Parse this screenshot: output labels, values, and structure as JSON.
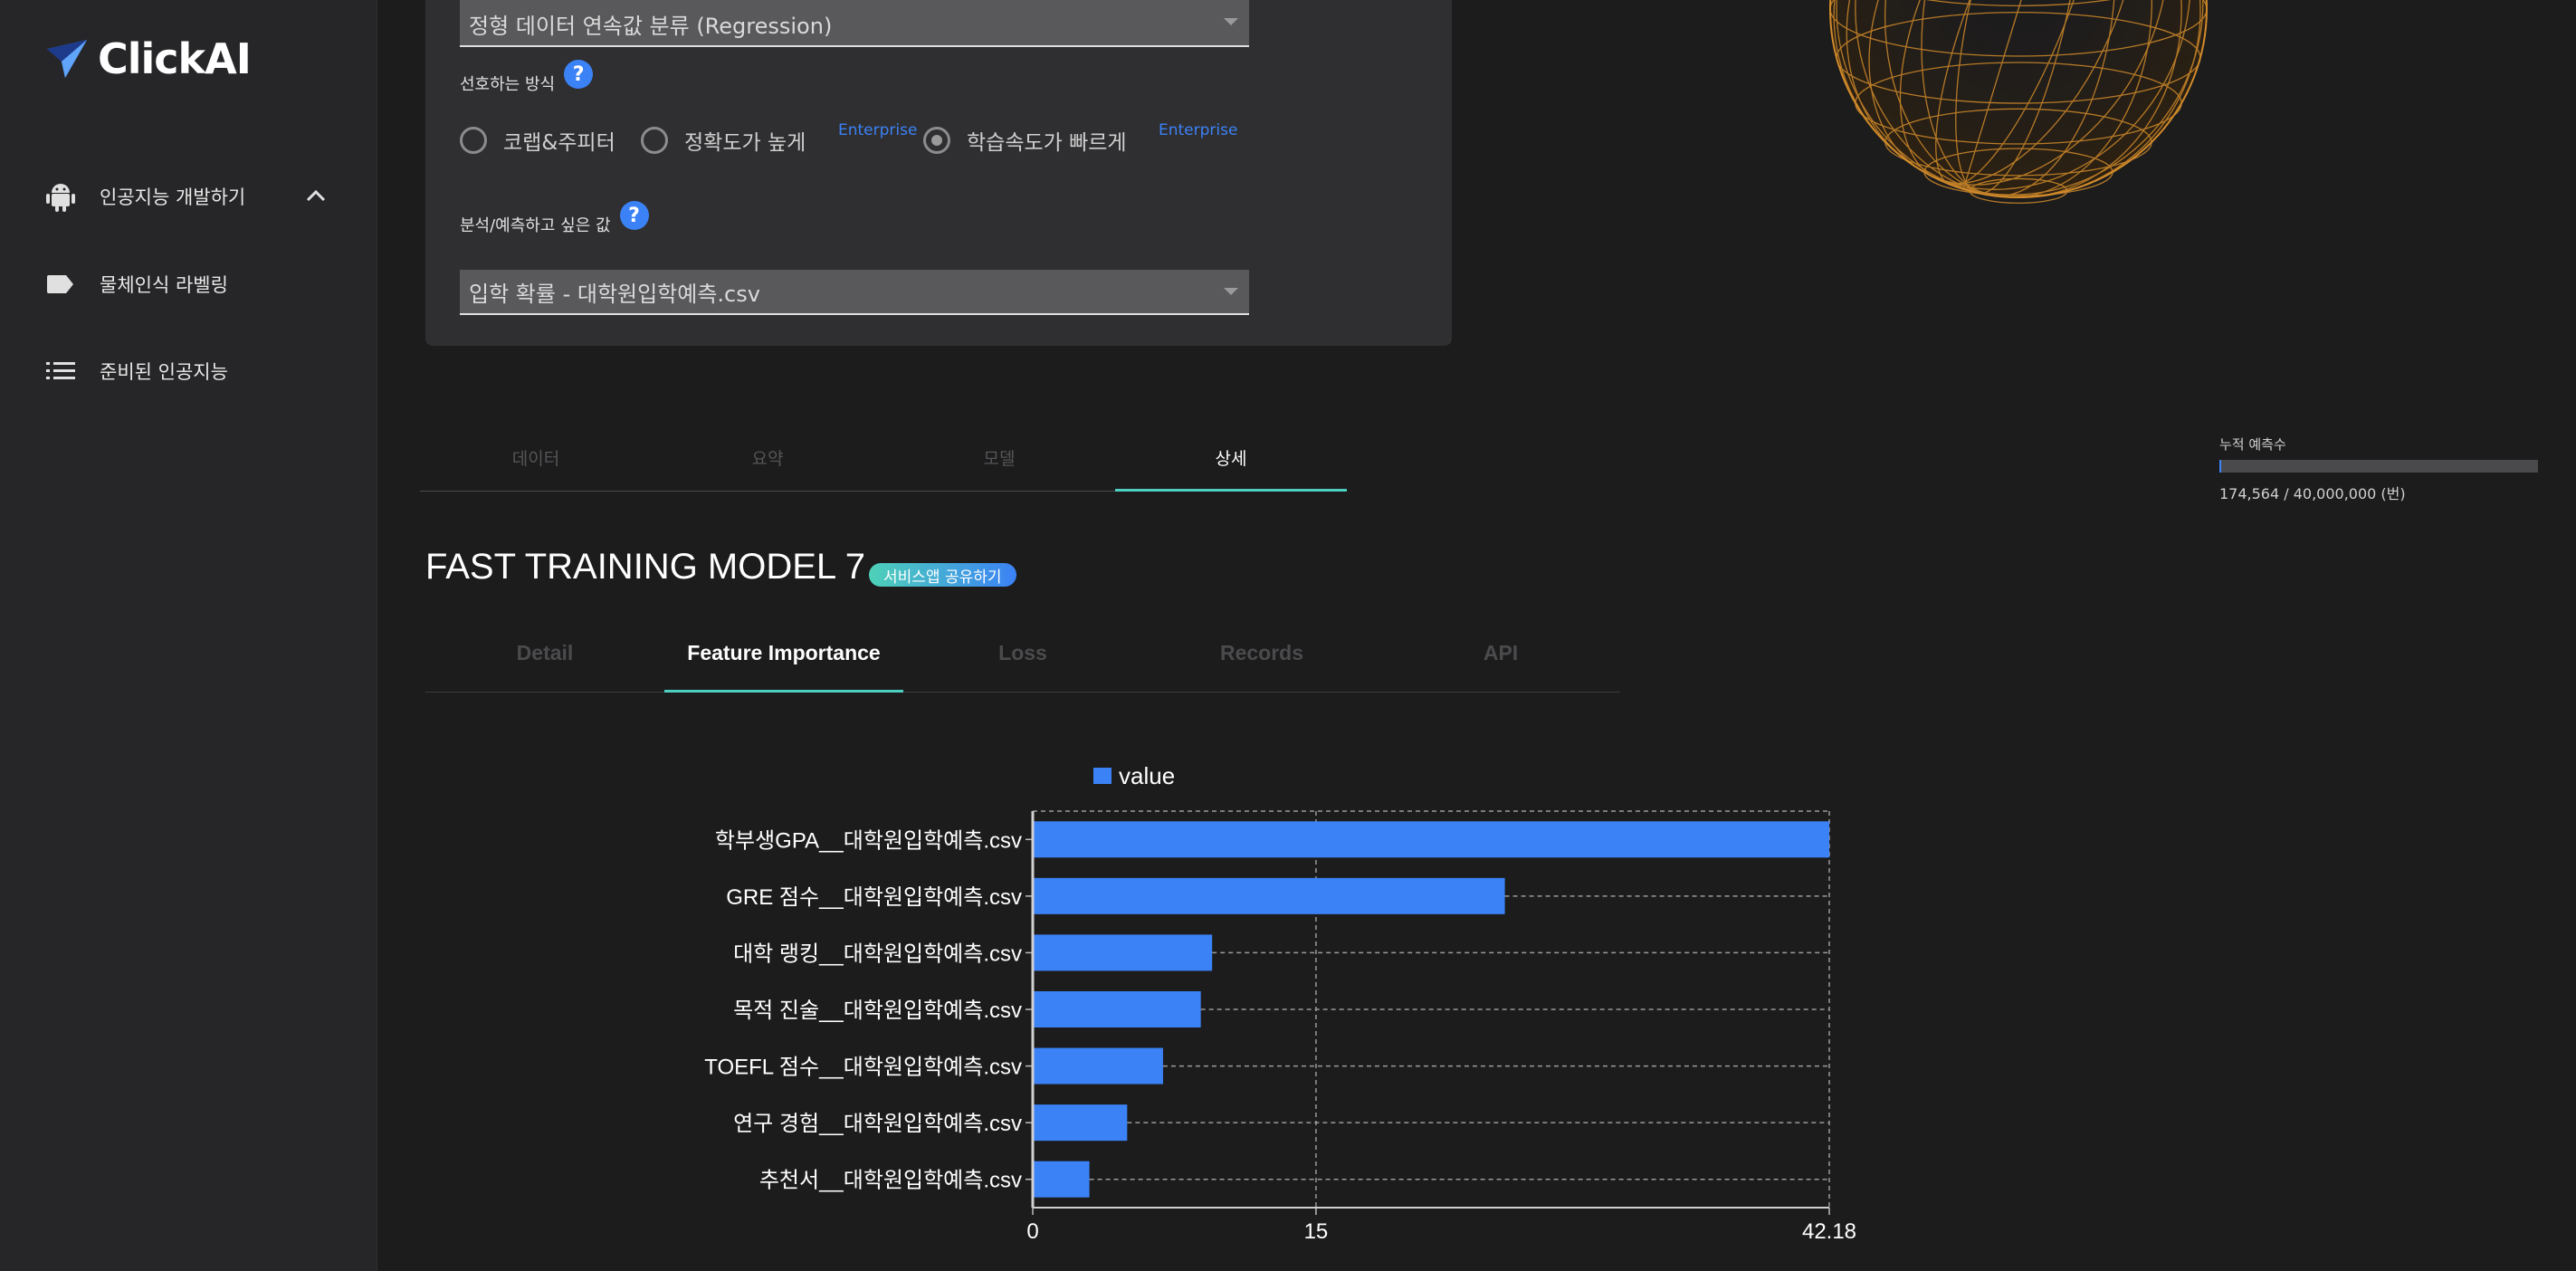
{
  "app": {
    "name": "ClickAI"
  },
  "sidebar": {
    "items": [
      {
        "label": "인공지능 개발하기",
        "icon": "android-icon",
        "expanded": true
      },
      {
        "label": "물체인식 라벨링",
        "icon": "label-tag-icon"
      },
      {
        "label": "준비된 인공지능",
        "icon": "list-icon"
      }
    ]
  },
  "form": {
    "problem_type": {
      "value": "정형 데이터 연속값 분류 (Regression)"
    },
    "preference": {
      "label": "선호하는 방식",
      "help": "?",
      "options": [
        {
          "label": "코랩&주피터",
          "selected": false,
          "badge": ""
        },
        {
          "label": "정확도가 높게",
          "selected": false,
          "badge": "Enterprise"
        },
        {
          "label": "학습속도가 빠르게",
          "selected": true,
          "badge": "Enterprise"
        }
      ]
    },
    "target": {
      "label": "분석/예측하고 싶은 값",
      "help": "?",
      "value": "입학 확률 - 대학원입학예측.csv"
    }
  },
  "prediction_count": {
    "label": "누적 예측수",
    "value_text": "174,564 / 40,000,000 (번)",
    "fraction": 0.0044
  },
  "top_tabs": [
    {
      "label": "데이터",
      "active": false
    },
    {
      "label": "요약",
      "active": false
    },
    {
      "label": "모델",
      "active": false
    },
    {
      "label": "상세",
      "active": true
    }
  ],
  "model": {
    "title": "FAST TRAINING MODEL 7",
    "share_label": "서비스앱 공유하기"
  },
  "sub_tabs": [
    {
      "label": "Detail",
      "active": false
    },
    {
      "label": "Feature Importance",
      "active": true
    },
    {
      "label": "Loss",
      "active": false
    },
    {
      "label": "Records",
      "active": false
    },
    {
      "label": "API",
      "active": false
    }
  ],
  "colors": {
    "accent": "#3b82f6",
    "tab_indicator": "#4dd0c1",
    "globe": "#d08a2a"
  },
  "chart_data": {
    "type": "bar",
    "orientation": "horizontal",
    "categories": [
      "학부생GPA__대학원입학예측.csv",
      "GRE 점수__대학원입학예측.csv",
      "대학 랭킹__대학원입학예측.csv",
      "목적 진술__대학원입학예측.csv",
      "TOEFL 점수__대학원입학예측.csv",
      "연구 경험__대학원입학예측.csv",
      "추천서__대학원입학예측.csv"
    ],
    "series": [
      {
        "name": "value",
        "values": [
          42.18,
          25.0,
          9.5,
          8.9,
          6.9,
          5.0,
          3.0
        ]
      }
    ],
    "xlim": [
      0,
      42.18
    ],
    "xticks": [
      "0",
      "15",
      "42.18"
    ],
    "grid": true,
    "legend": "top"
  }
}
